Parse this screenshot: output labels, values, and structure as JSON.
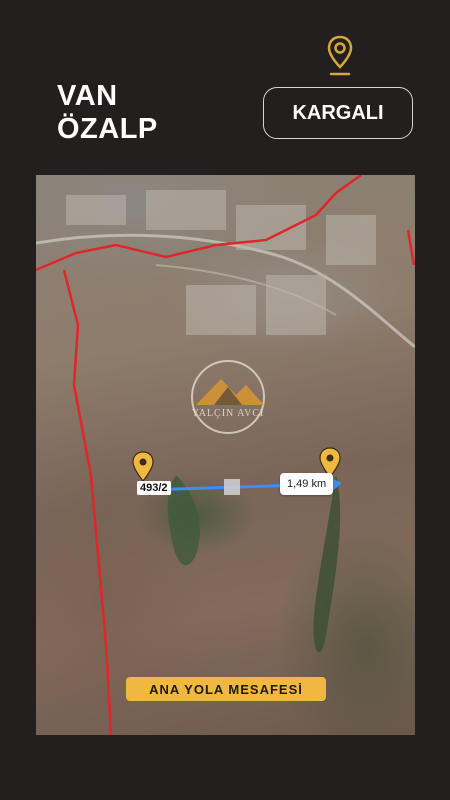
{
  "header": {
    "province": "VAN",
    "district": "ÖZALP",
    "location_button": "KARGALI",
    "pin_icon": "location-pin-icon"
  },
  "map": {
    "parcel_label": "493/2",
    "distance_label": "1,49 km",
    "caption": "ANA YOLA MESAFESİ",
    "watermark_text": "YALÇIN AVCI",
    "colors": {
      "border_line": "#e0262a",
      "measure_line": "#3d8bff",
      "pin": "#f0b840",
      "caption_bg": "#f0b840"
    }
  }
}
